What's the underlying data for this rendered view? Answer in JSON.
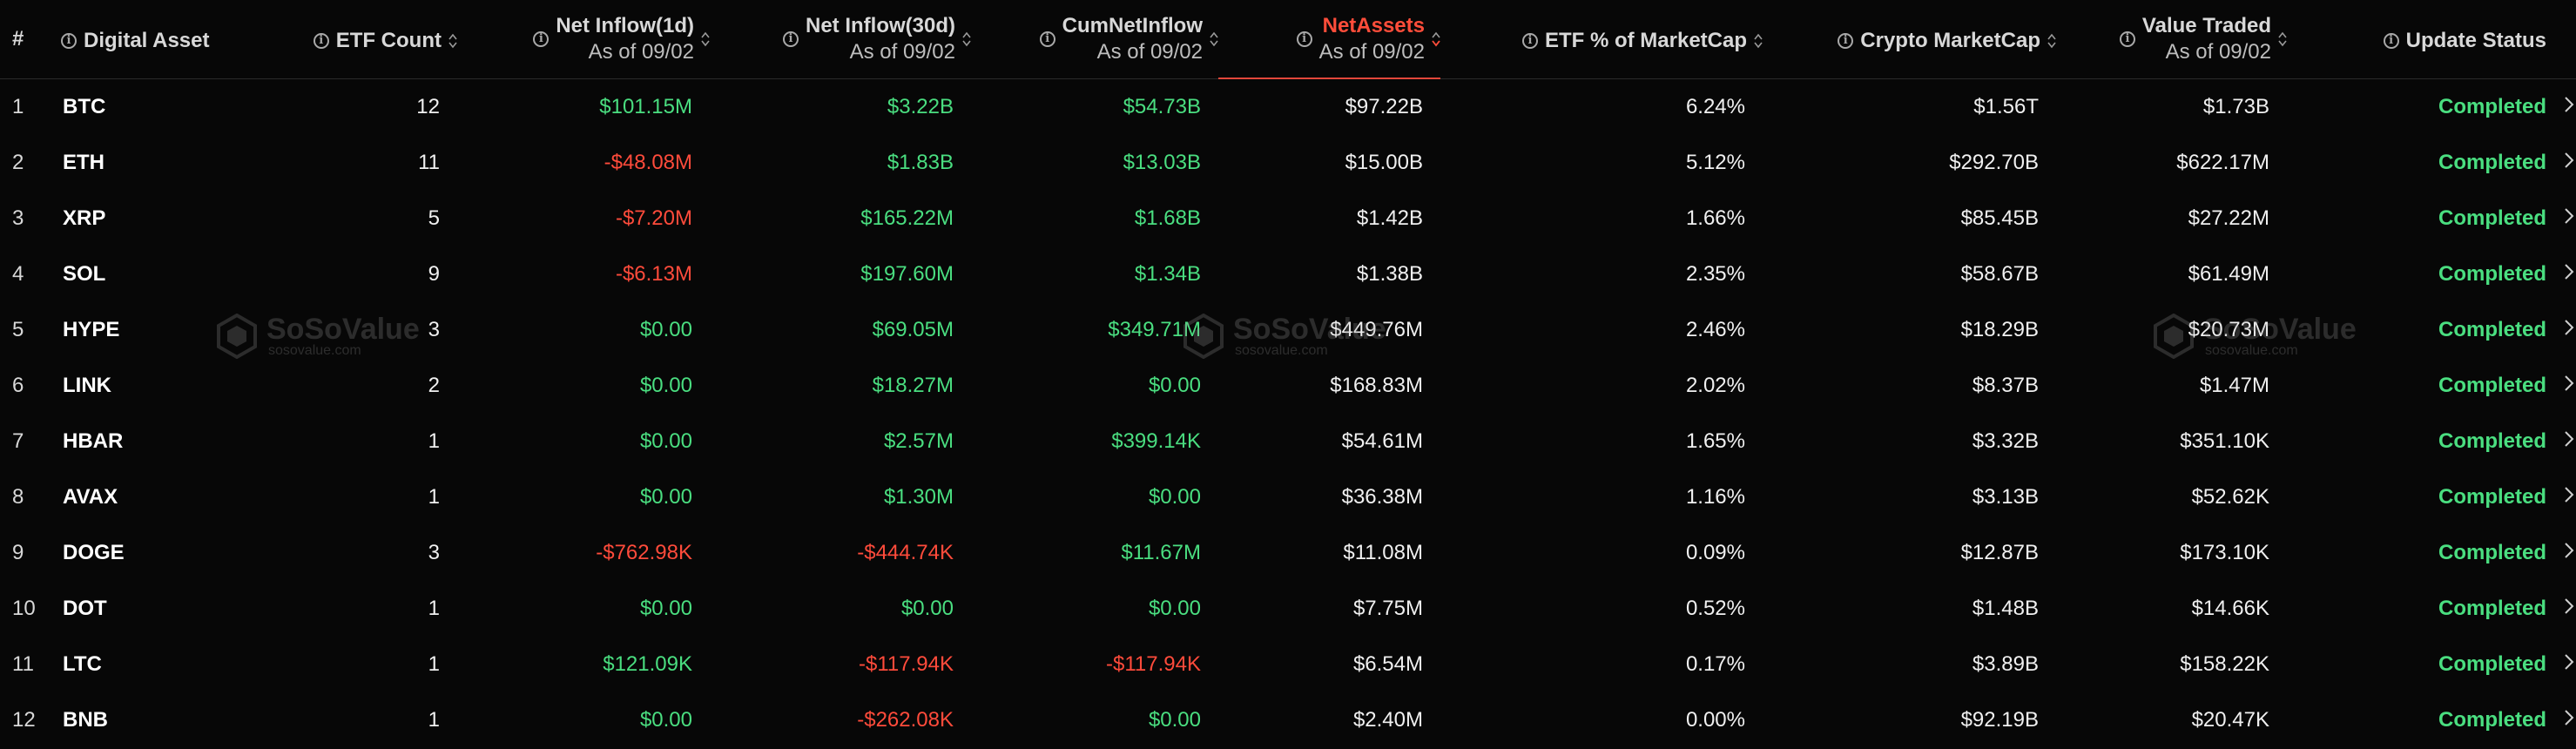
{
  "columns": {
    "index": "#",
    "asset": "Digital Asset",
    "etf_count": "ETF Count",
    "net_inflow_1d": "Net Inflow(1d)",
    "net_inflow_1d_sub": "As of 09/02",
    "net_inflow_30d": "Net Inflow(30d)",
    "net_inflow_30d_sub": "As of 09/02",
    "cum_net_inflow": "CumNetInflow",
    "cum_net_inflow_sub": "As of 09/02",
    "net_assets": "NetAssets",
    "net_assets_sub": "As of 09/02",
    "etf_pct": "ETF % of MarketCap",
    "crypto_mcap": "Crypto MarketCap",
    "value_traded": "Value Traded",
    "value_traded_sub": "As of 09/02",
    "update_status": "Update Status"
  },
  "rows": [
    {
      "idx": "1",
      "asset": "BTC",
      "etf_count": "12",
      "d1": "$101.15M",
      "d30": "$3.22B",
      "cum": "$54.73B",
      "net_assets": "$97.22B",
      "etf_pct": "6.24%",
      "mcap": "$1.56T",
      "traded": "$1.73B",
      "status": "Completed"
    },
    {
      "idx": "2",
      "asset": "ETH",
      "etf_count": "11",
      "d1": "-$48.08M",
      "d30": "$1.83B",
      "cum": "$13.03B",
      "net_assets": "$15.00B",
      "etf_pct": "5.12%",
      "mcap": "$292.70B",
      "traded": "$622.17M",
      "status": "Completed"
    },
    {
      "idx": "3",
      "asset": "XRP",
      "etf_count": "5",
      "d1": "-$7.20M",
      "d30": "$165.22M",
      "cum": "$1.68B",
      "net_assets": "$1.42B",
      "etf_pct": "1.66%",
      "mcap": "$85.45B",
      "traded": "$27.22M",
      "status": "Completed"
    },
    {
      "idx": "4",
      "asset": "SOL",
      "etf_count": "9",
      "d1": "-$6.13M",
      "d30": "$197.60M",
      "cum": "$1.34B",
      "net_assets": "$1.38B",
      "etf_pct": "2.35%",
      "mcap": "$58.67B",
      "traded": "$61.49M",
      "status": "Completed"
    },
    {
      "idx": "5",
      "asset": "HYPE",
      "etf_count": "3",
      "d1": "$0.00",
      "d30": "$69.05M",
      "cum": "$349.71M",
      "net_assets": "$449.76M",
      "etf_pct": "2.46%",
      "mcap": "$18.29B",
      "traded": "$20.73M",
      "status": "Completed"
    },
    {
      "idx": "6",
      "asset": "LINK",
      "etf_count": "2",
      "d1": "$0.00",
      "d30": "$18.27M",
      "cum": "$0.00",
      "net_assets": "$168.83M",
      "etf_pct": "2.02%",
      "mcap": "$8.37B",
      "traded": "$1.47M",
      "status": "Completed"
    },
    {
      "idx": "7",
      "asset": "HBAR",
      "etf_count": "1",
      "d1": "$0.00",
      "d30": "$2.57M",
      "cum": "$399.14K",
      "net_assets": "$54.61M",
      "etf_pct": "1.65%",
      "mcap": "$3.32B",
      "traded": "$351.10K",
      "status": "Completed"
    },
    {
      "idx": "8",
      "asset": "AVAX",
      "etf_count": "1",
      "d1": "$0.00",
      "d30": "$1.30M",
      "cum": "$0.00",
      "net_assets": "$36.38M",
      "etf_pct": "1.16%",
      "mcap": "$3.13B",
      "traded": "$52.62K",
      "status": "Completed"
    },
    {
      "idx": "9",
      "asset": "DOGE",
      "etf_count": "3",
      "d1": "-$762.98K",
      "d30": "-$444.74K",
      "cum": "$11.67M",
      "net_assets": "$11.08M",
      "etf_pct": "0.09%",
      "mcap": "$12.87B",
      "traded": "$173.10K",
      "status": "Completed"
    },
    {
      "idx": "10",
      "asset": "DOT",
      "etf_count": "1",
      "d1": "$0.00",
      "d30": "$0.00",
      "cum": "$0.00",
      "net_assets": "$7.75M",
      "etf_pct": "0.52%",
      "mcap": "$1.48B",
      "traded": "$14.66K",
      "status": "Completed"
    },
    {
      "idx": "11",
      "asset": "LTC",
      "etf_count": "1",
      "d1": "$121.09K",
      "d30": "-$117.94K",
      "cum": "-$117.94K",
      "net_assets": "$6.54M",
      "etf_pct": "0.17%",
      "mcap": "$3.89B",
      "traded": "$158.22K",
      "status": "Completed"
    },
    {
      "idx": "12",
      "asset": "BNB",
      "etf_count": "1",
      "d1": "$0.00",
      "d30": "-$262.08K",
      "cum": "$0.00",
      "net_assets": "$2.40M",
      "etf_pct": "0.00%",
      "mcap": "$92.19B",
      "traded": "$20.47K",
      "status": "Completed"
    }
  ],
  "watermark": {
    "brand": "SoSoValue",
    "url": "sosovalue.com"
  },
  "colors": {
    "positive": "#4ade80",
    "negative": "#ff4b3b",
    "active_header": "#ff4d3a",
    "background": "#070707"
  },
  "icons": {
    "info": "info-circle-icon",
    "sort": "sort-arrows-icon",
    "row_link": "chevron-right-icon"
  }
}
